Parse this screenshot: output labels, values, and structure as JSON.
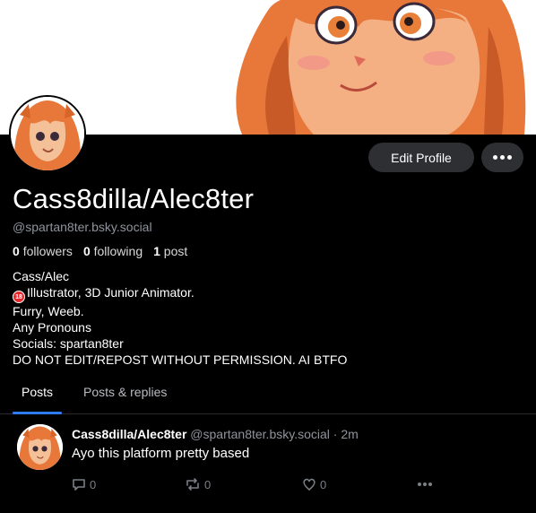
{
  "profile": {
    "display_name": "Cass8dilla/Alec8ter",
    "handle": "@spartan8ter.bsky.social",
    "edit_label": "Edit Profile",
    "stats": {
      "followers_count": "0",
      "followers_label": "followers",
      "following_count": "0",
      "following_label": "following",
      "posts_count": "1",
      "posts_label": "post"
    },
    "bio": {
      "line1": "Cass/Alec",
      "line2_badge": "18",
      "line2": "Illustrator, 3D Junior Animator.",
      "line3": "Furry, Weeb.",
      "line4": "Any Pronouns",
      "line5": "Socials: spartan8ter",
      "line6": "DO NOT EDIT/REPOST WITHOUT PERMISSION. AI BTFO"
    }
  },
  "tabs": [
    {
      "label": "Posts"
    },
    {
      "label": "Posts & replies"
    }
  ],
  "post": {
    "author_name": "Cass8dilla/Alec8ter",
    "author_handle": "@spartan8ter.bsky.social",
    "separator": "·",
    "time": "2m",
    "text": "Ayo this platform pretty based",
    "reply_count": "0",
    "repost_count": "0",
    "like_count": "0"
  },
  "colors": {
    "background": "#000000",
    "button_bg": "#2e2f33",
    "muted_text": "#8f939b",
    "tab_accent": "#2d7bf5",
    "hair_orange": "#e87a3e"
  },
  "icons": [
    "more-icon",
    "reply-icon",
    "repost-icon",
    "like-icon",
    "post-more-icon",
    "eighteen-plus-icon"
  ]
}
